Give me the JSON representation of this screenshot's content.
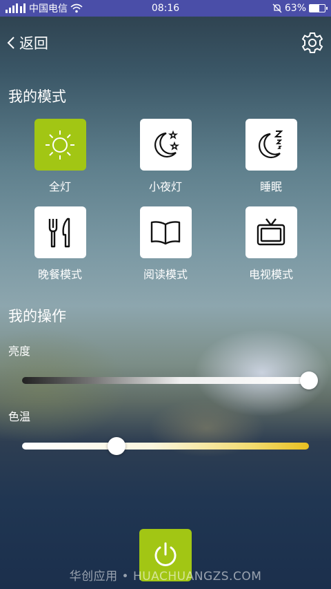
{
  "status": {
    "left_text": "中国电信",
    "time": "08:16",
    "battery": "63%",
    "battery_level": 0.63
  },
  "topbar": {
    "back_label": "返回",
    "settings_icon": "gear-icon"
  },
  "sections": {
    "modes_title": "我的模式",
    "ops_title": "我的操作"
  },
  "modes": [
    {
      "label": "全灯",
      "icon": "sun-icon",
      "active": true
    },
    {
      "label": "小夜灯",
      "icon": "moon-stars-icon",
      "active": false
    },
    {
      "label": "睡眠",
      "icon": "moon-zzz-icon",
      "active": false
    },
    {
      "label": "晚餐模式",
      "icon": "fork-knife-icon",
      "active": false
    },
    {
      "label": "阅读模式",
      "icon": "book-icon",
      "active": false
    },
    {
      "label": "电视模式",
      "icon": "tv-icon",
      "active": false
    }
  ],
  "controls": {
    "brightness_label": "亮度",
    "brightness_value": 1.0,
    "color_temp_label": "色温",
    "color_temp_value": 0.33
  },
  "colors": {
    "accent": "#a2c614",
    "statusbar": "#4a4ea8"
  },
  "power": {
    "icon": "power-icon"
  },
  "watermark": "华创应用 • HUACHUANGZS.COM"
}
